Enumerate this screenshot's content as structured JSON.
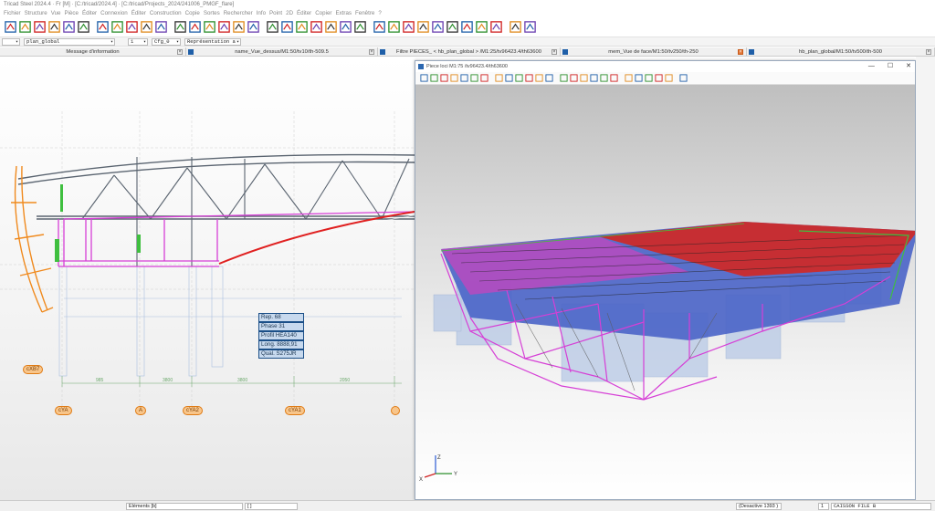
{
  "window": {
    "title": "Tricad Steel 2024.4 · Fr [M] · [C:/tricad/2024.4] · [C:/tricad/Projects_2024/241006_PMGF_flare]"
  },
  "menu": [
    "Fichier",
    "Structure",
    "Vue",
    "Pièce",
    "Éditer",
    "Connexion",
    "Éditer",
    "Construction",
    "Copie",
    "Sortes",
    "Rechercher",
    "Info",
    "Point",
    "2D",
    "Éditer",
    "Copier",
    "Extras",
    "Fenêtre",
    "?"
  ],
  "toolbar": {
    "icons": [
      "new-file-icon",
      "open-folder-icon",
      "open-recent-icon",
      "save-icon",
      "save-all-icon",
      "print-icon",
      "undo-icon",
      "refresh-icon",
      "rotate-icon",
      "bend-icon",
      "stairs-icon",
      "node-icon",
      "weld-icon",
      "connect-icon",
      "arc-icon",
      "move-icon",
      "copy-icon",
      "bracket-icon",
      "grid-icon",
      "cut-icon",
      "align-icon",
      "delete-piece-icon",
      "tag-icon",
      "check-icon",
      "list-icon",
      "export-icon",
      "document-icon",
      "nc-icon",
      "drawing-icon",
      "gear-doc-icon",
      "layer-icon",
      "plan-icon",
      "report-icon",
      "flag-icon",
      "globe-icon"
    ]
  },
  "selectors": {
    "first": "",
    "plan": "plan_global",
    "scale": "1",
    "config": "Cfg_0",
    "representation": "Représentation a"
  },
  "tabs": [
    {
      "label": "Message d'information"
    },
    {
      "label": "name_Vue_dessus/M1:50/tv10/th-509.5"
    },
    {
      "label": "Filtre PIECES_ < hb_plan_global > /M1:25/tv96423.4/th63600"
    },
    {
      "label": "mem_Vue de face/M1:50/tv250/th-250"
    },
    {
      "label": "hb_plan_global/M1:50/tv500/th-500"
    }
  ],
  "drawing": {
    "tooltip": {
      "rep": "Rep.   68",
      "phase": "Phase 31",
      "profil": "Profil  HEA140",
      "long": "Long.  8888,91",
      "qual": "Qual.  S275JR"
    },
    "axes": [
      "cYA",
      "A",
      "cYA2",
      "cYA1",
      "cXB7"
    ],
    "dims": [
      "985",
      "3800",
      "3800",
      "2050"
    ]
  },
  "viewer": {
    "title": "Piece loci M1:75 /tv96423.4/th63600",
    "controls": [
      "—",
      "☐",
      "✕"
    ],
    "axis_labels": {
      "x": "X",
      "y": "Y",
      "z": "Z"
    }
  },
  "status": {
    "elements": "Eléments [b]",
    "bracket": "[ ]",
    "desactive": "(Desactive 1393 )",
    "count": "1",
    "layer": "CAISSON FILE B"
  },
  "colors": {
    "magenta": "#d63fd6",
    "orange": "#f08a1e",
    "red": "#e02020",
    "steel": "#5a6470",
    "blue": "#2c5bd4"
  }
}
